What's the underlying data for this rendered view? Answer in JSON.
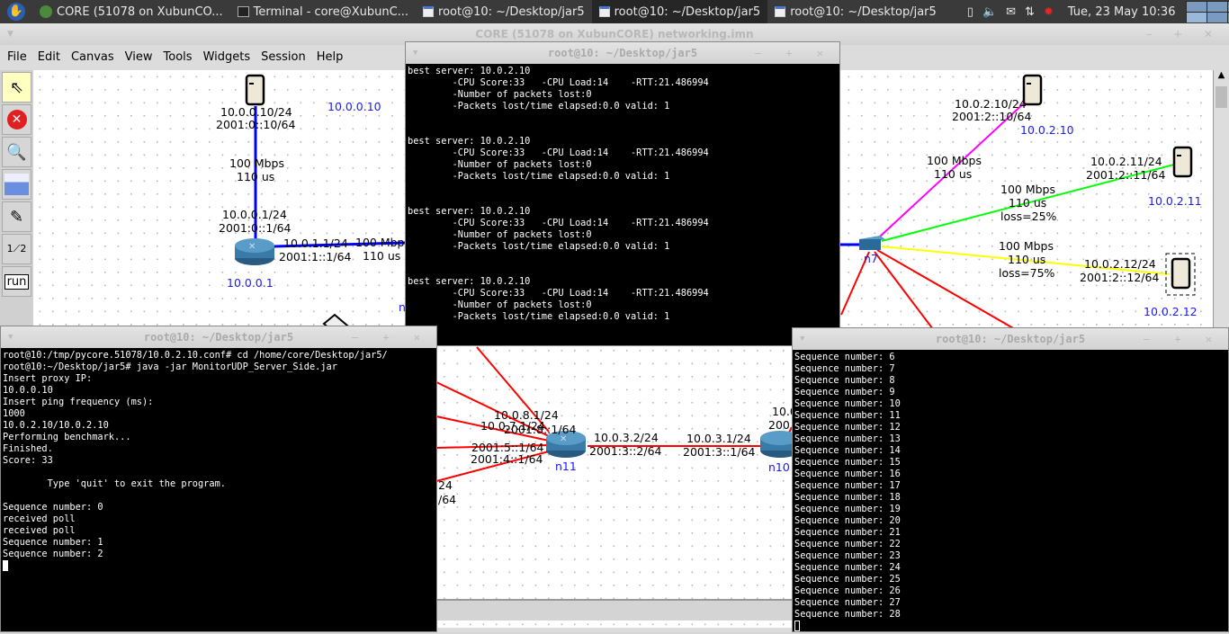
{
  "taskbar": {
    "items": [
      "CORE (51078 on XubunCO...",
      "Terminal - core@XubunC...",
      "root@10: ~/Desktop/jar5",
      "root@10: ~/Desktop/jar5",
      "root@10: ~/Desktop/jar5"
    ],
    "clock": "Tue, 23 May  10:36",
    "user": "core"
  },
  "core": {
    "title": "CORE (51078 on XubunCORE) networking.imn",
    "menus": [
      "File",
      "Edit",
      "Canvas",
      "View",
      "Tools",
      "Widgets",
      "Session",
      "Help"
    ],
    "tools": [
      "select-tool",
      "stop-tool",
      "zoom-tool",
      "throughput-tool",
      "marker-tool",
      "two-node-tool",
      "run-tool"
    ],
    "run_label": "run",
    "labels": {
      "a1": "10.0.0.10/24",
      "a2": "2001:0::10/64",
      "a3": "10.0.0.10",
      "a4": "100 Mbps",
      "a5": "110 us",
      "a6": "10.0.0.1/24",
      "a7": "2001:0::1/64",
      "a8": "10.0.1.1/24",
      "a9": "2001:1::1/64",
      "a10": "100 Mbp",
      "a11": "110 us",
      "a12": "10.0.0.1",
      "a13": "n",
      "b1": "10.0.2.10/24",
      "b2": "2001:2::10/64",
      "b3": "10.0.2.10",
      "b4": "100 Mbps",
      "b5": "110 us",
      "b6": "10.0.2.11/24",
      "b7": "2001:2::11/64",
      "b8": "10.0.2.11",
      "b9": "100 Mbps",
      "b10": "110 us",
      "b11": "loss=25%",
      "b12": "100 Mbps",
      "b13": "110 us",
      "b14": "loss=75%",
      "b15": "10.0.2.12/24",
      "b16": "2001:2::12/64",
      "b17": "10.0.2.12",
      "b18": "n7",
      "c1": "10.0.8.1/24",
      "c2": "10.0.7.1/24",
      "c3": "2001:8::1/64",
      "c4": "2001:5::1/64",
      "c5": "2001:4::1/64",
      "c6": "24",
      "c7": "/64",
      "c8": "10.0.3.2/24",
      "c9": "2001:3::2/64",
      "c10": "10.0.3.1/24",
      "c11": "2001:3::1/64",
      "c12": "n11",
      "c13": "n10",
      "c14": "10.0",
      "c15": "200"
    }
  },
  "term_top": {
    "title": "root@10: ~/Desktop/jar5",
    "blocks": [
      "best server: 10.0.2.10\n        -CPU Score:33   -CPU Load:14    -RTT:21.486994\n        -Number of packets lost:0\n        -Packets lost/time elapsed:0.0 valid: 1\n\n",
      "best server: 10.0.2.10\n        -CPU Score:33   -CPU Load:14    -RTT:21.486994\n        -Number of packets lost:0\n        -Packets lost/time elapsed:0.0 valid: 1\n\n",
      "best server: 10.0.2.10\n        -CPU Score:33   -CPU Load:14    -RTT:21.486994\n        -Number of packets lost:0\n        -Packets lost/time elapsed:0.0 valid: 1\n\n",
      "best server: 10.0.2.10\n        -CPU Score:33   -CPU Load:14    -RTT:21.486994\n        -Number of packets lost:0\n        -Packets lost/time elapsed:0.0 valid: 1"
    ]
  },
  "term_left": {
    "title": "root@10: ~/Desktop/jar5",
    "text": "root@10:/tmp/pycore.51078/10.0.2.10.conf# cd /home/core/Desktop/jar5/\nroot@10:~/Desktop/jar5# java -jar MonitorUDP_Server_Side.jar\nInsert proxy IP:\n10.0.0.10\nInsert ping frequency (ms):\n1000\n10.0.2.10/10.0.2.10\nPerforming benchmark...\nFinished.\nScore: 33\n\n        Type 'quit' to exit the program.\n\nSequence number: 0\nreceived poll\nreceived poll\nSequence number: 1\nSequence number: 2"
  },
  "term_right": {
    "title": "root@10: ~/Desktop/jar5",
    "text": "Sequence number: 6\nSequence number: 7\nSequence number: 8\nSequence number: 9\nSequence number: 10\nSequence number: 11\nSequence number: 12\nSequence number: 13\nSequence number: 14\nSequence number: 15\nSequence number: 16\nSequence number: 17\nSequence number: 18\nSequence number: 19\nSequence number: 20\nSequence number: 21\nSequence number: 22\nSequence number: 23\nSequence number: 24\nSequence number: 25\nSequence number: 26\nSequence number: 27\nSequence number: 28"
  },
  "colors": {
    "link_blue": "#0000ff",
    "link_red": "#ff0000",
    "link_magenta": "#ff00ff",
    "link_green": "#00ff00",
    "link_yellow": "#ffff00",
    "node_label": "#1a1aff"
  }
}
